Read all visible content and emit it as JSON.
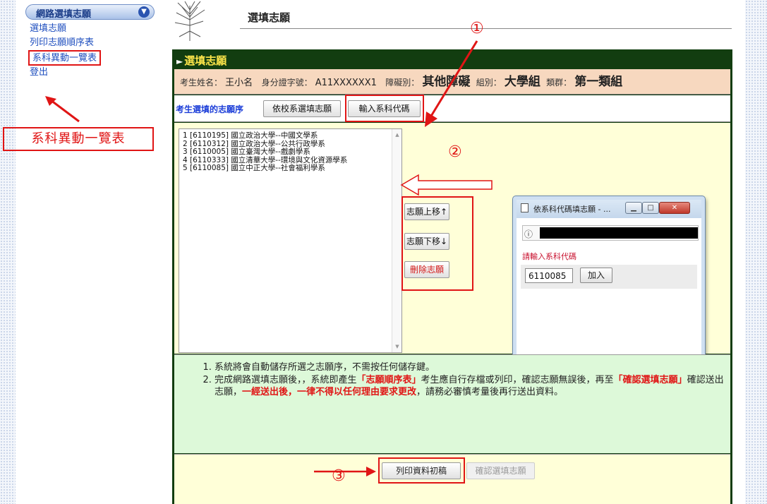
{
  "sidebar": {
    "menu_header": "網路選填志願",
    "links": [
      "選填志願",
      "列印志願順序表",
      "系科異動一覽表",
      "登出"
    ],
    "annotation": "系科異動一覽表"
  },
  "header": {
    "title": "選填志願"
  },
  "panel": {
    "title": "選填志願",
    "info": {
      "name_label": "考生姓名：",
      "name": "王小名",
      "id_label": "身分證字號：",
      "id": "A11XXXXXX1",
      "disability_label": "障礙別：",
      "disability": "其他障礙",
      "group_label": "組別：",
      "group": "大學組",
      "cluster_label": "類群：",
      "cluster": "第一類組"
    },
    "tab_label": "考生選填的志願序",
    "tab_buttons": {
      "by_school": "依校系選填志願",
      "enter_code": "輸入系科代碼"
    },
    "choices": [
      "1 [6110195] 國立政治大學--中國文學系",
      "2 [6110312] 國立政治大學--公共行政學系",
      "3 [6110005] 國立臺灣大學--戲劇學系",
      "4 [6110333] 國立清華大學--環境與文化資源學系",
      "5 [6110085] 國立中正大學--社會福利學系"
    ],
    "side_buttons": {
      "up": "志願上移↑",
      "down": "志願下移↓",
      "delete": "刪除志願"
    },
    "notes": {
      "n1": "系統將會自動儲存所選之志願序，不需按任何儲存鍵。",
      "n2_a": "完成網路選填志願後，，系統即產生",
      "n2_b": "「志願順序表」",
      "n2_c": "考生應自行存檔或列印，確認志願無誤後，再至",
      "n2_d": "「確認選填志願」",
      "n2_e": "確認送出志願，",
      "n2_f": "一經送出後，一律不得以任何理由要求更改",
      "n2_g": "，請務必審慎考量後再行送出資料。"
    },
    "footer": {
      "print": "列印資料初稿",
      "confirm": "確認選填志願"
    }
  },
  "popup": {
    "title": "依系科代碼填志願 - ...",
    "prompt": "請輸入系科代碼",
    "code_value": "6110085",
    "add_label": "加入"
  },
  "annotations": {
    "c1": "①",
    "c2": "②",
    "c3": "③"
  },
  "colors": {
    "highlight": "#e01515",
    "panel_bg": "#123d10",
    "title_yellow": "#ffe64a"
  }
}
